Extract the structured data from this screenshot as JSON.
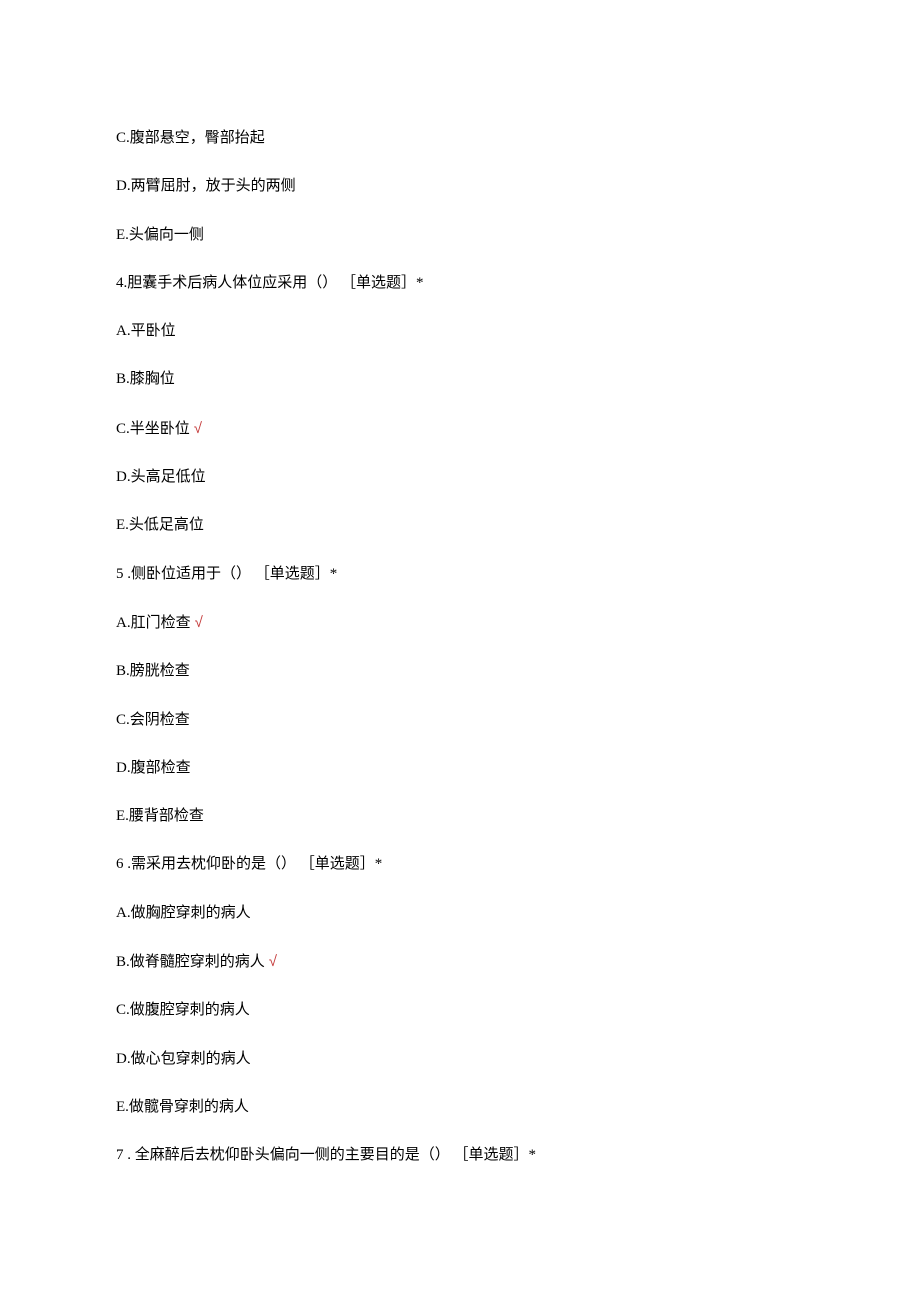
{
  "stray_options": [
    {
      "label": "C.腹部悬空，臀部抬起"
    },
    {
      "label": "D.两臂屈肘，放于头的两侧"
    },
    {
      "label": "E.头偏向一侧"
    }
  ],
  "questions": [
    {
      "stem": "4.胆囊手术后病人体位应采用（） ［单选题］*",
      "options": [
        {
          "label": "A.平卧位",
          "correct": false
        },
        {
          "label": "B.膝胸位",
          "correct": false
        },
        {
          "label": "C.半坐卧位",
          "correct": true
        },
        {
          "label": "D.头高足低位",
          "correct": false
        },
        {
          "label": "E.头低足高位",
          "correct": false
        }
      ]
    },
    {
      "stem": "5   .侧卧位适用于（） ［单选题］*",
      "options": [
        {
          "label": "A.肛门检查",
          "correct": true
        },
        {
          "label": "B.膀胱检查",
          "correct": false
        },
        {
          "label": "C.会阴检查",
          "correct": false
        },
        {
          "label": "D.腹部检查",
          "correct": false
        },
        {
          "label": "E.腰背部检查",
          "correct": false
        }
      ]
    },
    {
      "stem": "6   .需采用去枕仰卧的是（） ［单选题］*",
      "options": [
        {
          "label": "A.做胸腔穿刺的病人",
          "correct": false
        },
        {
          "label": "B.做脊髓腔穿刺的病人",
          "correct": true
        },
        {
          "label": "C.做腹腔穿刺的病人",
          "correct": false
        },
        {
          "label": "D.做心包穿刺的病人",
          "correct": false
        },
        {
          "label": "E.做髋骨穿刺的病人",
          "correct": false
        }
      ]
    },
    {
      "stem": "7   . 全麻醉后去枕仰卧头偏向一侧的主要目的是（） ［单选题］*",
      "options": []
    }
  ],
  "correct_mark": "√"
}
